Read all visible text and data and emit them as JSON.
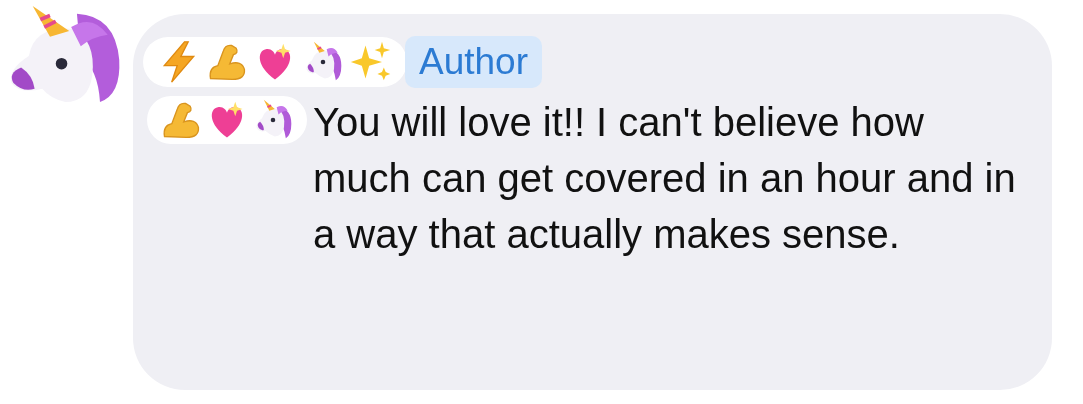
{
  "author": {
    "name_emojis": [
      {
        "kind": "lightning"
      },
      {
        "kind": "arm"
      },
      {
        "kind": "heart"
      },
      {
        "kind": "unicorn"
      },
      {
        "kind": "sparkles"
      }
    ],
    "badge": "Author"
  },
  "message": {
    "prefix_emojis": [
      {
        "kind": "arm"
      },
      {
        "kind": "heart"
      },
      {
        "kind": "unicorn"
      }
    ],
    "text": "You will love it!! I can't believe how much can get covered in an hour and in a way that actually makes sense."
  }
}
